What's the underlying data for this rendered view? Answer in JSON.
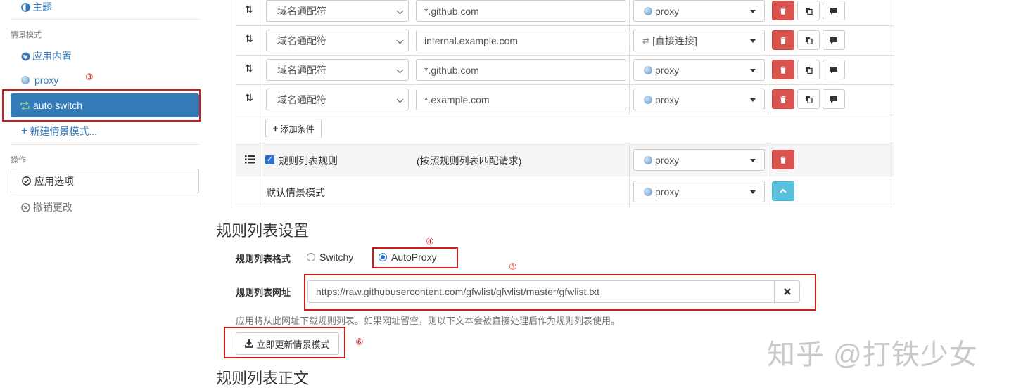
{
  "sidebar": {
    "theme_label": "主题",
    "profiles_heading": "情景模式",
    "items": [
      {
        "label": "应用内置"
      },
      {
        "label": "proxy"
      },
      {
        "label": "auto switch"
      },
      {
        "label": "新建情景模式..."
      }
    ],
    "actions_heading": "操作",
    "apply_label": "应用选项",
    "revert_label": "撤销更改"
  },
  "annotations": {
    "m3": "③",
    "m4": "④",
    "m5": "⑤",
    "m6": "⑥"
  },
  "rules": [
    {
      "type": "域名通配符",
      "pattern": "*.github.com",
      "profile": "proxy"
    },
    {
      "type": "域名通配符",
      "pattern": "internal.example.com",
      "profile": "[直接连接]"
    },
    {
      "type": "域名通配符",
      "pattern": "*.github.com",
      "profile": "proxy"
    },
    {
      "type": "域名通配符",
      "pattern": "*.example.com",
      "profile": "proxy"
    }
  ],
  "add_condition_label": "添加条件",
  "rule_list_row": {
    "label": "规则列表规则",
    "desc": "(按照规则列表匹配请求)",
    "profile": "proxy",
    "checked": true
  },
  "default_row": {
    "label": "默认情景模式",
    "profile": "proxy"
  },
  "rule_list_settings": {
    "title": "规则列表设置",
    "format_label": "规则列表格式",
    "formats": [
      "Switchy",
      "AutoProxy"
    ],
    "selected_format": "AutoProxy",
    "url_label": "规则列表网址",
    "url_value": "https://raw.githubusercontent.com/gfwlist/gfwlist/master/gfwlist.txt",
    "help": "应用将从此网址下载规则列表。如果网址留空，则以下文本会被直接处理后作为规则列表使用。",
    "update_button": "立即更新情景模式"
  },
  "rule_list_text_title": "规则列表正文",
  "watermark": "知乎 @打铁少女",
  "colors": {
    "primary": "#337ab7",
    "danger": "#d9534f",
    "info": "#5bc0de",
    "annotation": "#d11a1a"
  }
}
